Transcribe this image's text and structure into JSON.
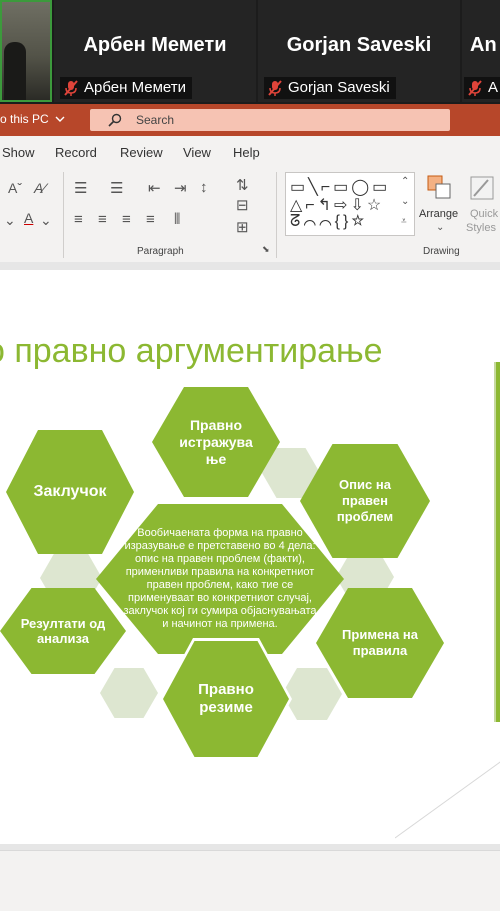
{
  "video_strip": {
    "participants": [
      {
        "name": "Арбен Мемети",
        "display_name": "Арбен Мемети",
        "muted": true
      },
      {
        "name": "Gorjan Saveski",
        "display_name": "Gorjan Saveski",
        "muted": true
      },
      {
        "name": "An",
        "display_name": "A",
        "muted": true
      }
    ]
  },
  "title_bar": {
    "save_location": "o this PC",
    "search_placeholder": "Search"
  },
  "ribbon": {
    "tabs": [
      "Show",
      "Record",
      "Review",
      "View",
      "Help"
    ],
    "groups": {
      "paragraph": "Paragraph",
      "drawing": "Drawing"
    },
    "buttons": {
      "arrange": "Arrange",
      "quick_styles_line1": "Quick",
      "quick_styles_line2": "Styles"
    }
  },
  "slide": {
    "title": "о правно аргументирање",
    "hexagons": {
      "pravno_istrazuvanje": "Правно истражува ње",
      "zakluchok": "Заклучок",
      "opis_na_praven_problem": "Опис на правен проблем",
      "center": "Вообичаената форма на правно изразување е претставено во 4 дела: опис на правен проблем (факти), применливи правила на конкретниот правен проблем, како тие се применуваат во конкретниот случај, заклучок кој ги сумира објаснувањата и начинот на примена.",
      "rezultati": "Резултати од анализа",
      "primena": "Примена на правила",
      "pravno_rezime": "Правно резиме"
    }
  },
  "colors": {
    "accent_green": "#8cb832",
    "pale_hex": "#dde6d0",
    "title_bar": "#b7472a",
    "search_box": "#f6c3b3",
    "muted_mic": "#e0443a"
  }
}
